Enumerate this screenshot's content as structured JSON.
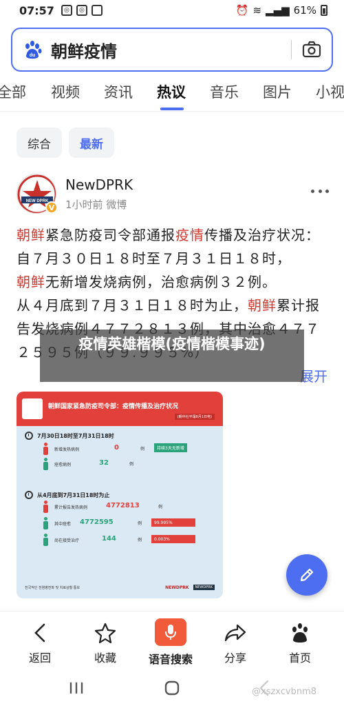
{
  "status_bar": {
    "time": "07:57",
    "battery": "61%"
  },
  "search": {
    "query": "朝鲜疫情"
  },
  "tabs": [
    {
      "label": "全部",
      "active": false
    },
    {
      "label": "视频",
      "active": false
    },
    {
      "label": "资讯",
      "active": false
    },
    {
      "label": "热议",
      "active": true
    },
    {
      "label": "音乐",
      "active": false
    },
    {
      "label": "图片",
      "active": false
    },
    {
      "label": "小视",
      "active": false
    }
  ],
  "filters": {
    "comprehensive": "综合",
    "latest": "最新"
  },
  "post": {
    "author": "NewDPRK",
    "avatar_text": "NEW DPRK",
    "meta": "1小时前 微博",
    "body_parts": [
      {
        "text": "朝鲜",
        "hl": true
      },
      {
        "text": "紧急防疫司令部通报",
        "hl": false
      },
      {
        "text": "疫情",
        "hl": true
      },
      {
        "text": "传播及治疗状况：",
        "hl": false
      },
      {
        "text": "\n自７月３０日１８时至７月３１日１８时，\n",
        "hl": false
      },
      {
        "text": "朝鲜",
        "hl": true
      },
      {
        "text": "无新增发烧病例，治愈病例３２例。\n从４月底到７月３１日１８时为止，",
        "hl": false
      },
      {
        "text": "朝鲜",
        "hl": true
      },
      {
        "text": "累计报告发烧病例４７７２８１３例，其中治愈４７７２５９５例（９９.９９５%）",
        "hl": false
      }
    ],
    "expand": "展开",
    "overlay_title": "疫情英雄楷模(疫情楷模事迹)"
  },
  "infographic": {
    "title": "朝鲜国家紧急防疫司令部：疫情传播及治疗状况",
    "subtitle": "(朝中社平壤8月1日电)",
    "section1": "7月30日18时至7月31日18时",
    "row_new_label": "新增发热病例",
    "row_new_value": "0",
    "row_new_unit": "例",
    "tag_text": "持续3天无新增",
    "row_cured_label": "痊愈病例",
    "row_cured_value": "32",
    "row_cured_unit": "例",
    "section2": "从4月底到7月31日18时为止",
    "row_total_label": "累计报告发热病例",
    "row_total_value": "4772813",
    "row_total_unit": "例",
    "row_healed_label": "其中痊愈",
    "row_healed_value": "4772595",
    "row_healed_unit": "例",
    "row_healed_pct": "99.995%",
    "row_treat_label": "尚在接受治疗",
    "row_treat_value": "144",
    "row_treat_unit": "例",
    "row_treat_pct": "0.003%",
    "footer_text": "전국적인 전염병전파 및 치료상황 통보",
    "footer_brand": "NEWDPRK",
    "footer_brand2": "NEWDPRK",
    "colors": {
      "header": "#e2403b",
      "bar": "#e2403b",
      "tag": "#2aa37a",
      "green_person": "#2aa37a",
      "red_person": "#e2403b"
    }
  },
  "bottom_nav": [
    {
      "label": "返回",
      "icon": "back-icon"
    },
    {
      "label": "收藏",
      "icon": "star-icon"
    },
    {
      "label": "语音搜索",
      "icon": "microphone-icon"
    },
    {
      "label": "分享",
      "icon": "share-icon"
    },
    {
      "label": "首页",
      "icon": "paw-icon"
    }
  ],
  "watermark": "@xszxcvbnm8",
  "colors": {
    "accent": "#4e6ef2",
    "highlight": "#d0392f",
    "voice": "#f25b39"
  }
}
